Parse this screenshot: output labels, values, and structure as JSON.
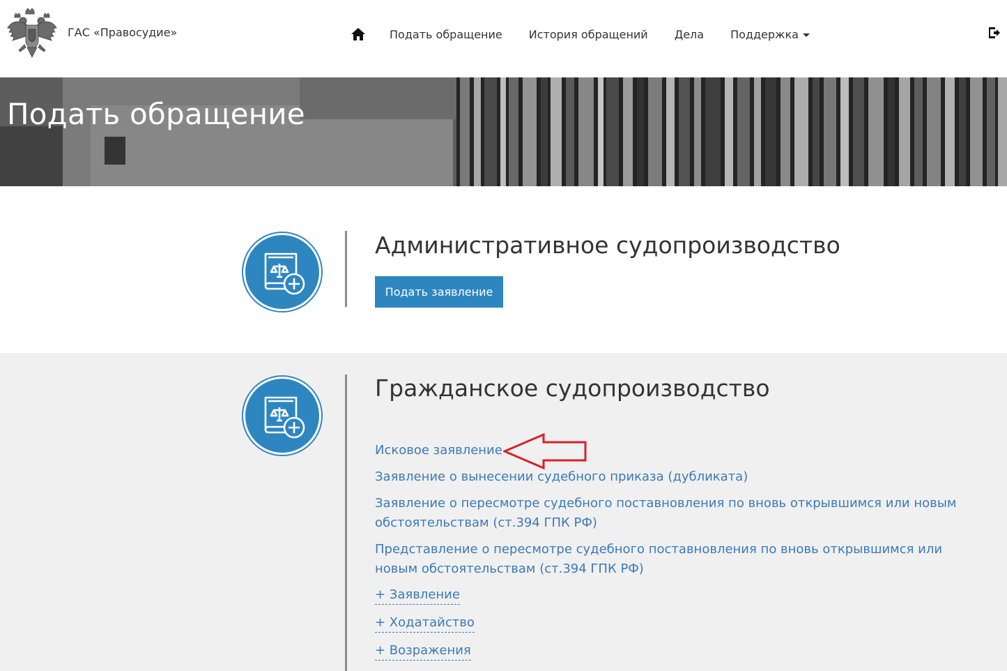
{
  "header": {
    "brand_name": "ГАС «Правосудие»",
    "nav": {
      "home_icon": "home-icon",
      "items": [
        "Подать обращение",
        "История обращений",
        "Дела",
        "Поддержка"
      ]
    },
    "logout_icon": "logout-icon"
  },
  "banner": {
    "title": "Подать обращение"
  },
  "sections": {
    "admin": {
      "title": "Административное судопроизводство",
      "button_label": "Подать заявление",
      "icon": "law-book-add-icon"
    },
    "civil": {
      "title": "Гражданское судопроизводство",
      "icon": "law-book-add-icon",
      "links": [
        "Исковое заявление",
        "Заявление о вынесении судебного приказа (дубликата)",
        "Заявление о пересмотре судебного поставновления по вновь открывшимся или новым обстоятельствам (ст.394 ГПК РФ)",
        "Представление о пересмотре судебного поставновления по вновь открывшимся или новым обстоятельствам (ст.394 ГПК РФ)"
      ],
      "expandable": [
        "+ Заявление",
        "+ Ходатайство",
        "+ Возражения"
      ]
    }
  },
  "colors": {
    "accent": "#2e86c1",
    "link": "#3a7ab8",
    "annotation_arrow": "#d9202a"
  }
}
